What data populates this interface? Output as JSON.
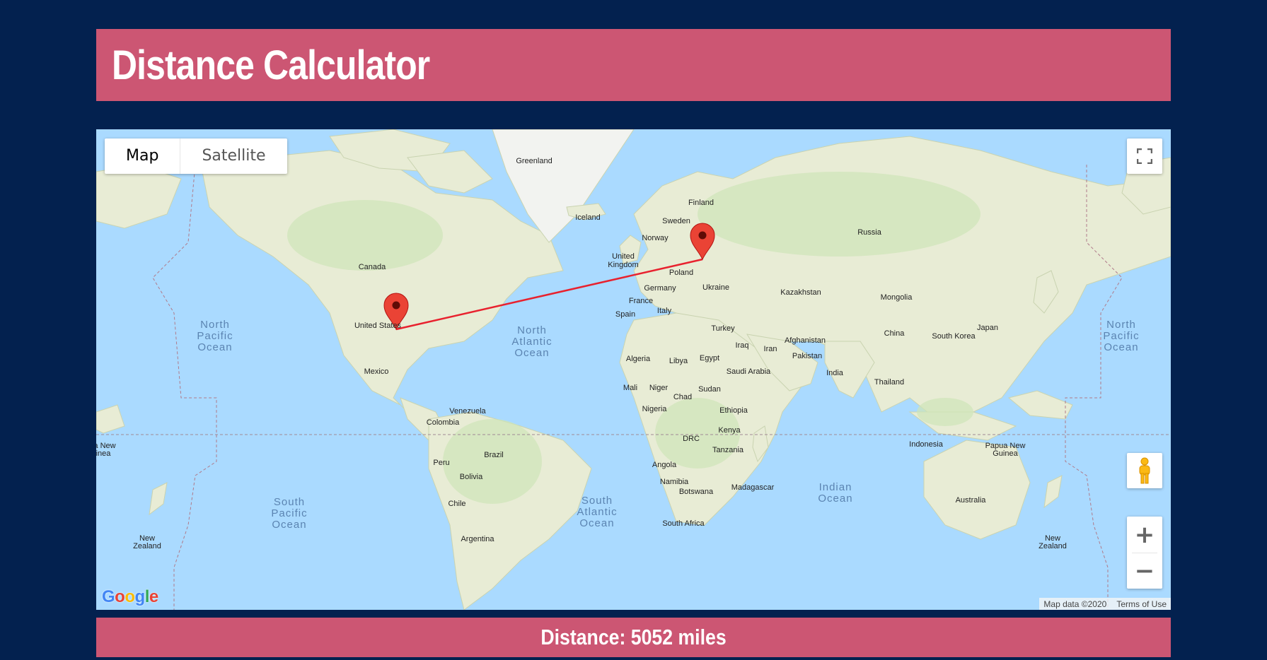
{
  "header": {
    "title": "Distance Calculator"
  },
  "map": {
    "type_control": {
      "map_label": "Map",
      "satellite_label": "Satellite",
      "selected": "Map"
    },
    "zoom_in_label": "+",
    "zoom_out_label": "−",
    "logo_text": "Google",
    "attribution": {
      "map_data": "Map data ©2020",
      "terms": "Terms of Use"
    },
    "markers": [
      {
        "name": "United States marker",
        "color": "#ea4335"
      },
      {
        "name": "Europe marker",
        "color": "#ea4335"
      }
    ],
    "route_color": "#e8212e",
    "labels": {
      "greenland": "Greenland",
      "iceland": "Iceland",
      "finland": "Finland",
      "sweden": "Sweden",
      "norway": "Norway",
      "russia": "Russia",
      "uk_line1": "United",
      "uk_line2": "Kingdom",
      "canada": "Canada",
      "poland": "Poland",
      "germany": "Germany",
      "ukraine": "Ukraine",
      "kazakhstan": "Kazakhstan",
      "mongolia": "Mongolia",
      "france": "France",
      "italy": "Italy",
      "spain": "Spain",
      "turkey": "Turkey",
      "united_states": "United States",
      "north_pacific_left": "North Pacific Ocean",
      "north_atlantic": "North Atlantic Ocean",
      "china": "China",
      "south_korea": "South Korea",
      "japan": "Japan",
      "north_pacific_right": "North Pacific Ocean",
      "afghanistan": "Afghanistan",
      "iraq": "Iraq",
      "iran": "Iran",
      "pakistan": "Pakistan",
      "algeria": "Algeria",
      "libya": "Libya",
      "egypt": "Egypt",
      "saudi_arabia": "Saudi Arabia",
      "india": "India",
      "mexico": "Mexico",
      "thailand": "Thailand",
      "mali": "Mali",
      "niger": "Niger",
      "chad": "Chad",
      "sudan": "Sudan",
      "venezuela": "Venezuela",
      "nigeria": "Nigeria",
      "ethiopia": "Ethiopia",
      "colombia": "Colombia",
      "kenya": "Kenya",
      "drc": "DRC",
      "png_left_line1": "a New",
      "png_left_line2": "inea",
      "indonesia": "Indonesia",
      "png_line1": "Papua New",
      "png_line2": "Guinea",
      "tanzania": "Tanzania",
      "peru": "Peru",
      "brazil": "Brazil",
      "angola": "Angola",
      "bolivia": "Bolivia",
      "namibia": "Namibia",
      "madagascar": "Madagascar",
      "indian_ocean": "Indian Ocean",
      "botswana": "Botswana",
      "south_pacific": "South Pacific Ocean",
      "south_atlantic": "South Atlantic Ocean",
      "australia": "Australia",
      "chile": "Chile",
      "south_africa": "South Africa",
      "argentina": "Argentina",
      "nz_left_line1": "New",
      "nz_left_line2": "Zealand",
      "nz_right_line1": "New",
      "nz_right_line2": "Zealand"
    }
  },
  "footer": {
    "distance_text": "Distance: 5052 miles"
  }
}
